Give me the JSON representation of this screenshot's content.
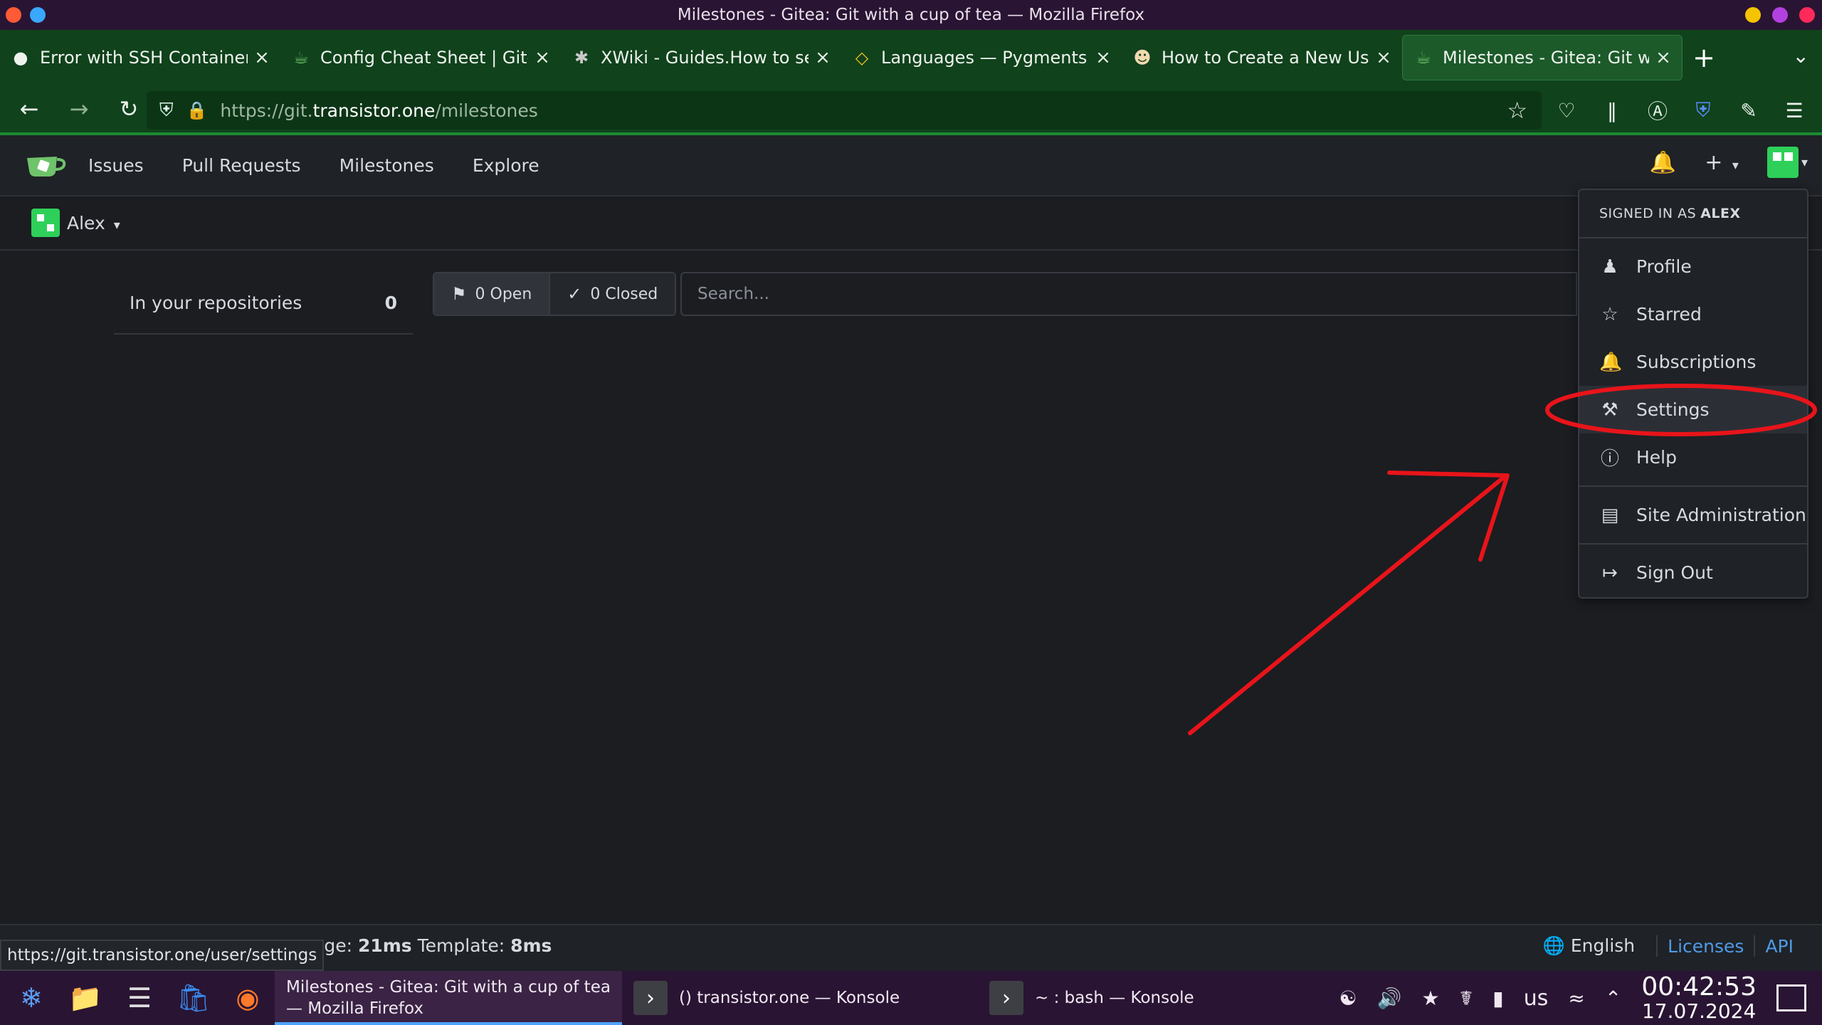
{
  "window": {
    "title": "Milestones - Gitea: Git with a cup of tea — Mozilla Firefox"
  },
  "tabs": [
    {
      "label": "Error with SSH Container F",
      "icon": "github-icon"
    },
    {
      "label": "Config Cheat Sheet | Gitea",
      "icon": "gitea-icon"
    },
    {
      "label": "XWiki - Guides.How to set u",
      "icon": "xwiki-icon"
    },
    {
      "label": "Languages — Pygments",
      "icon": "pygments-icon"
    },
    {
      "label": "How to Create a New User",
      "icon": "user-guide-icon"
    },
    {
      "label": "Milestones - Gitea: Git with",
      "icon": "gitea-icon"
    }
  ],
  "address": {
    "url_prefix": "https://git.",
    "url_domain": "transistor.one",
    "url_path": "/milestones"
  },
  "gitea": {
    "nav": {
      "issues": "Issues",
      "pulls": "Pull Requests",
      "milestones": "Milestones",
      "explore": "Explore"
    },
    "context_user": "Alex",
    "sidebar": {
      "label": "In your repositories",
      "count": "0"
    },
    "filters": {
      "open": "0 Open",
      "closed": "0 Closed"
    },
    "search": {
      "placeholder": "Search..."
    },
    "dropdown": {
      "signed_in_prefix": "SIGNED IN AS",
      "signed_in_user": "ALEX",
      "items": {
        "profile": "Profile",
        "starred": "Starred",
        "subscriptions": "Subscriptions",
        "settings": "Settings",
        "help": "Help",
        "site_admin": "Site Administration",
        "sign_out": "Sign Out"
      }
    },
    "footer": {
      "page_prefix": "age: ",
      "page_time": "21ms",
      "template_prefix": " Template: ",
      "template_time": "8ms",
      "language": "English",
      "licenses": "Licenses",
      "api": "API"
    },
    "status_link": "https://git.transistor.one/user/settings"
  },
  "taskbar": {
    "tasks": {
      "firefox": "Milestones - Gitea: Git with a cup of tea — Mozilla Firefox",
      "konsole1": "() transistor.one — Konsole",
      "konsole2": "~ : bash — Konsole"
    },
    "keyboard_layout": "us",
    "time": "00:42:53",
    "date": "17.07.2024"
  },
  "colors": {
    "accent_green": "#1b8a32",
    "annotation_red": "#e8141a",
    "link_blue": "#4e9be8"
  }
}
